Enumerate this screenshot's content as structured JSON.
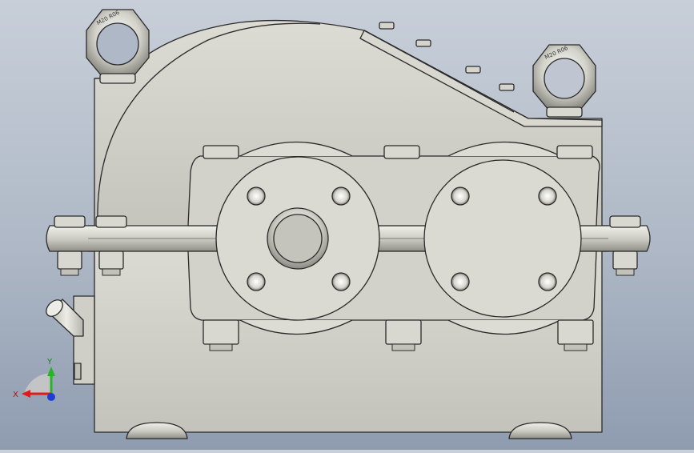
{
  "colors": {
    "background_top": "#c8cfd9",
    "background_bottom": "#8f9cb0",
    "metal_fill": "#cbcbc3",
    "metal_light": "#e6e6df",
    "metal_shadow": "#8d8d86",
    "edge": "#2a2a2a",
    "axis_x": "#e01b1b",
    "axis_y": "#27b427",
    "axis_z": "#1b3fd6"
  },
  "eye_bolt_marking": "M20 R06",
  "triad": {
    "x_label": "X",
    "y_label": "Y"
  },
  "icons": [
    "gearbox-housing",
    "eye-bolt",
    "hex-nut",
    "breather-valve",
    "bearing-cover",
    "coordinate-triad-icon"
  ]
}
